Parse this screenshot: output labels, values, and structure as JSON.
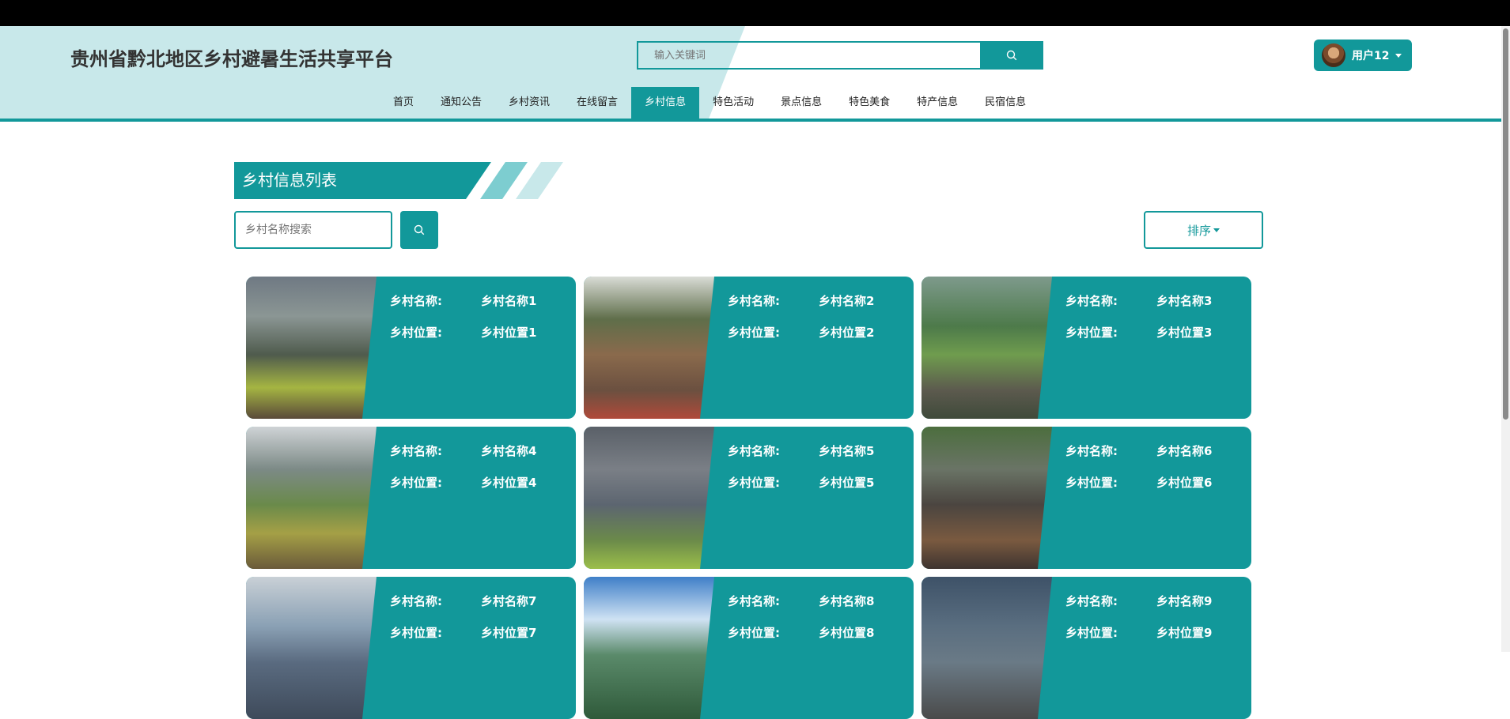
{
  "header": {
    "site_title": "贵州省黔北地区乡村避暑生活共享平台",
    "search_placeholder": "输入关键词",
    "user_name": "用户12"
  },
  "nav": {
    "items": [
      "首页",
      "通知公告",
      "乡村资讯",
      "在线留言",
      "乡村信息",
      "特色活动",
      "景点信息",
      "特色美食",
      "特产信息",
      "民宿信息"
    ],
    "active": "乡村信息"
  },
  "main": {
    "section_title": "乡村信息列表",
    "search_placeholder": "乡村名称搜索",
    "sort_label": "排序",
    "name_label": "乡村名称:",
    "location_label": "乡村位置:"
  },
  "cards": [
    {
      "name": "乡村名称1",
      "location": "乡村位置1"
    },
    {
      "name": "乡村名称2",
      "location": "乡村位置2"
    },
    {
      "name": "乡村名称3",
      "location": "乡村位置3"
    },
    {
      "name": "乡村名称4",
      "location": "乡村位置4"
    },
    {
      "name": "乡村名称5",
      "location": "乡村位置5"
    },
    {
      "name": "乡村名称6",
      "location": "乡村位置6"
    },
    {
      "name": "乡村名称7",
      "location": "乡村位置7"
    },
    {
      "name": "乡村名称8",
      "location": "乡村位置8"
    },
    {
      "name": "乡村名称9",
      "location": "乡村位置9"
    }
  ],
  "colors": {
    "accent": "#12989a",
    "header_bg": "#c8e8ea"
  },
  "icons": {
    "search": "search-icon",
    "user_menu": "chevron-down-icon"
  }
}
